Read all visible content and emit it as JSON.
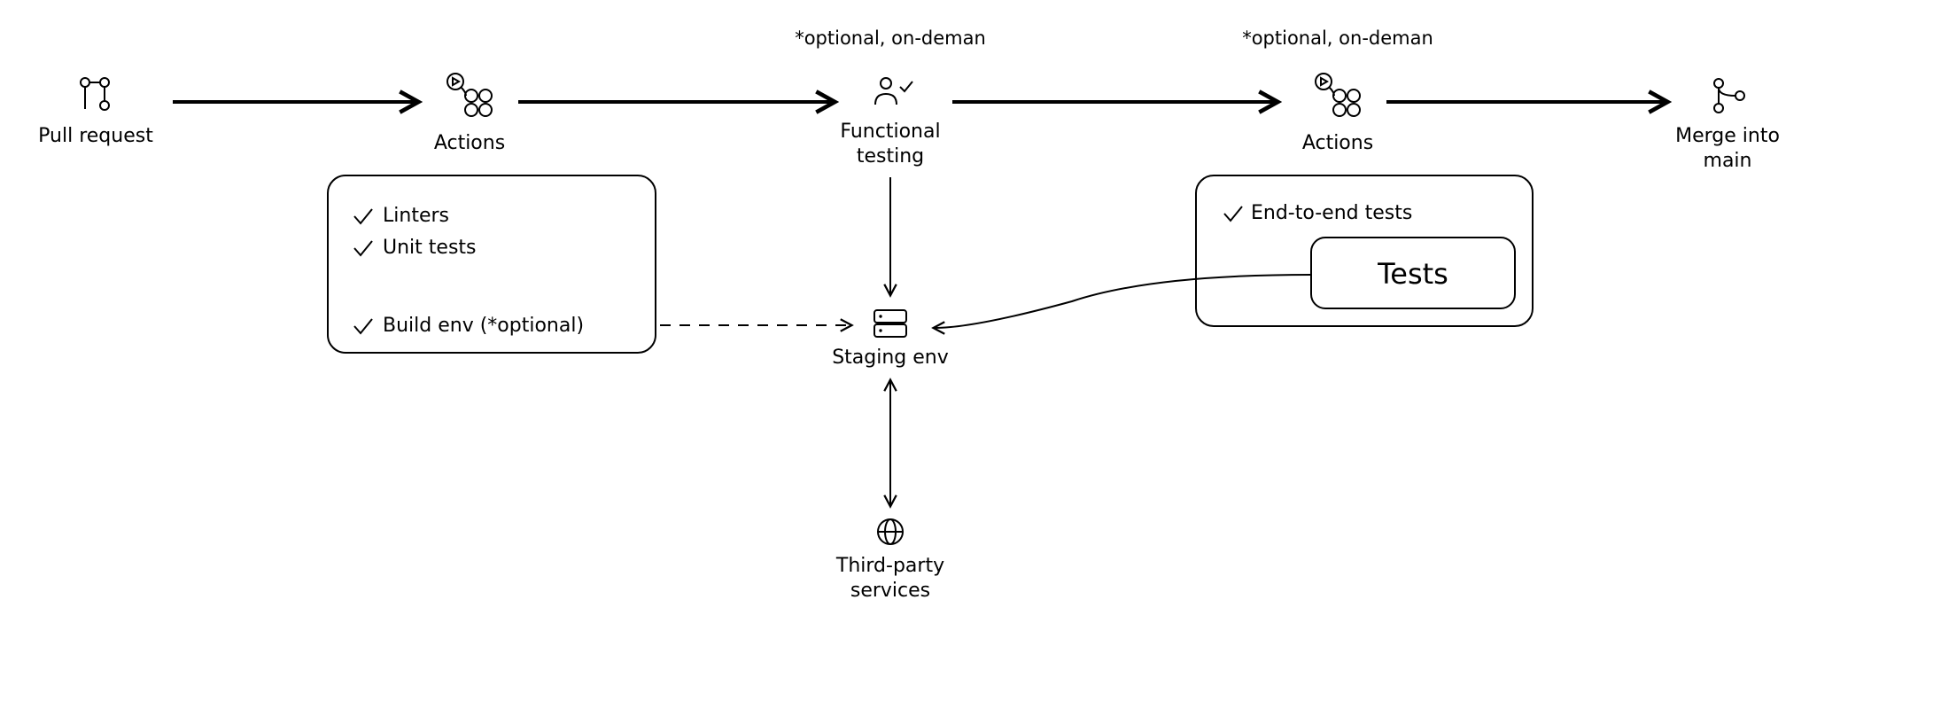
{
  "annotations": {
    "opt1": "*optional, on-deman",
    "opt2": "*optional, on-deman"
  },
  "nodes": {
    "pull": "Pull request",
    "actions1": "Actions",
    "functional1": "Functional",
    "functional2": "testing",
    "actions2": "Actions",
    "merge1": "Merge into",
    "merge2": "main",
    "staging": "Staging env",
    "third1": "Third-party",
    "third2": "services"
  },
  "box1": {
    "linters": "Linters",
    "unit": "Unit tests",
    "build": "Build env (*optional)"
  },
  "box2": {
    "e2e": "End-to-end tests",
    "tests": "Tests"
  }
}
